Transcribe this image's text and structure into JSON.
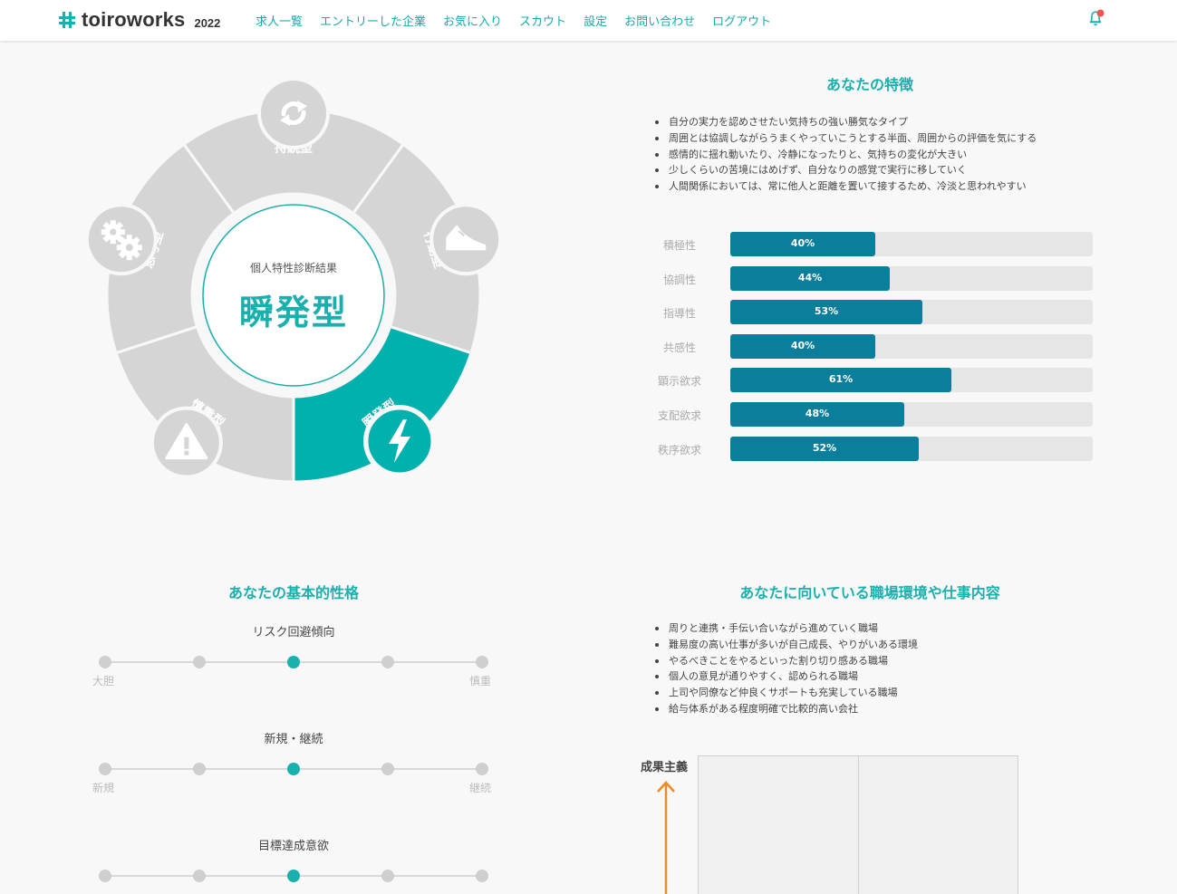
{
  "header": {
    "logo_text": "toiroworks",
    "logo_year": "2022",
    "nav": [
      "求人一覧",
      "エントリーした企業",
      "お気に入り",
      "スカウト",
      "設定",
      "お問い合わせ",
      "ログアウト"
    ],
    "brand_color": "#19b0ad"
  },
  "wheel": {
    "center_caption": "個人特性診断結果",
    "center_type": "瞬発型",
    "segments": [
      "持続型",
      "行動型",
      "瞬発型",
      "慎重型",
      "思考型"
    ],
    "active_segment": "瞬発型",
    "icons": [
      "refresh-icon",
      "sneaker-icon",
      "lightning-icon",
      "warning-icon",
      "gears-icon"
    ],
    "active_color": "#00b1ad",
    "inactive_color": "#d5d5d5"
  },
  "features": {
    "title": "あなたの特徴",
    "items": [
      "自分の実力を認めさせたい気持ちの強い勝気なタイプ",
      "周囲とは協調しながらうまくやっていこうとする半面、周囲からの評価を気にする",
      "感情的に揺れ動いたり、冷静になったりと、気持ちの変化が大きい",
      "少しくらいの苦境にはめげず、自分なりの感覚で実行に移していく",
      "人間関係においては、常に他人と距離を置いて接するため、冷淡と思われやすい"
    ]
  },
  "bars": [
    {
      "label": "積極性",
      "value": 40,
      "text": "40%"
    },
    {
      "label": "協調性",
      "value": 44,
      "text": "44%"
    },
    {
      "label": "指導性",
      "value": 53,
      "text": "53%"
    },
    {
      "label": "共感性",
      "value": 40,
      "text": "40%"
    },
    {
      "label": "顕示欲求",
      "value": 61,
      "text": "61%"
    },
    {
      "label": "支配欲求",
      "value": 48,
      "text": "48%"
    },
    {
      "label": "秩序欲求",
      "value": 52,
      "text": "52%"
    }
  ],
  "basic": {
    "title": "あなたの基本的性格",
    "traits": [
      {
        "name": "リスク回避傾向",
        "left": "大胆",
        "right": "慎重",
        "level": 3,
        "steps": 5
      },
      {
        "name": "新規・継続",
        "left": "新規",
        "right": "継続",
        "level": 3,
        "steps": 5
      },
      {
        "name": "目標達成意欲",
        "left": "",
        "right": "",
        "level": 3,
        "steps": 5
      }
    ]
  },
  "workplace": {
    "title": "あなたに向いている職場環境や仕事内容",
    "items": [
      "周りと連携・手伝い合いながら進めていく職場",
      "難易度の高い仕事が多いが自己成長、やりがいある環境",
      "やるべきことをやるといった割り切り感ある職場",
      "個人の意見が通りやすく、認められる職場",
      "上司や同僚など仲良くサポートも充実している職場",
      "給与体系がある程度明確で比較的高い会社"
    ],
    "axis_label": "成果主義"
  }
}
